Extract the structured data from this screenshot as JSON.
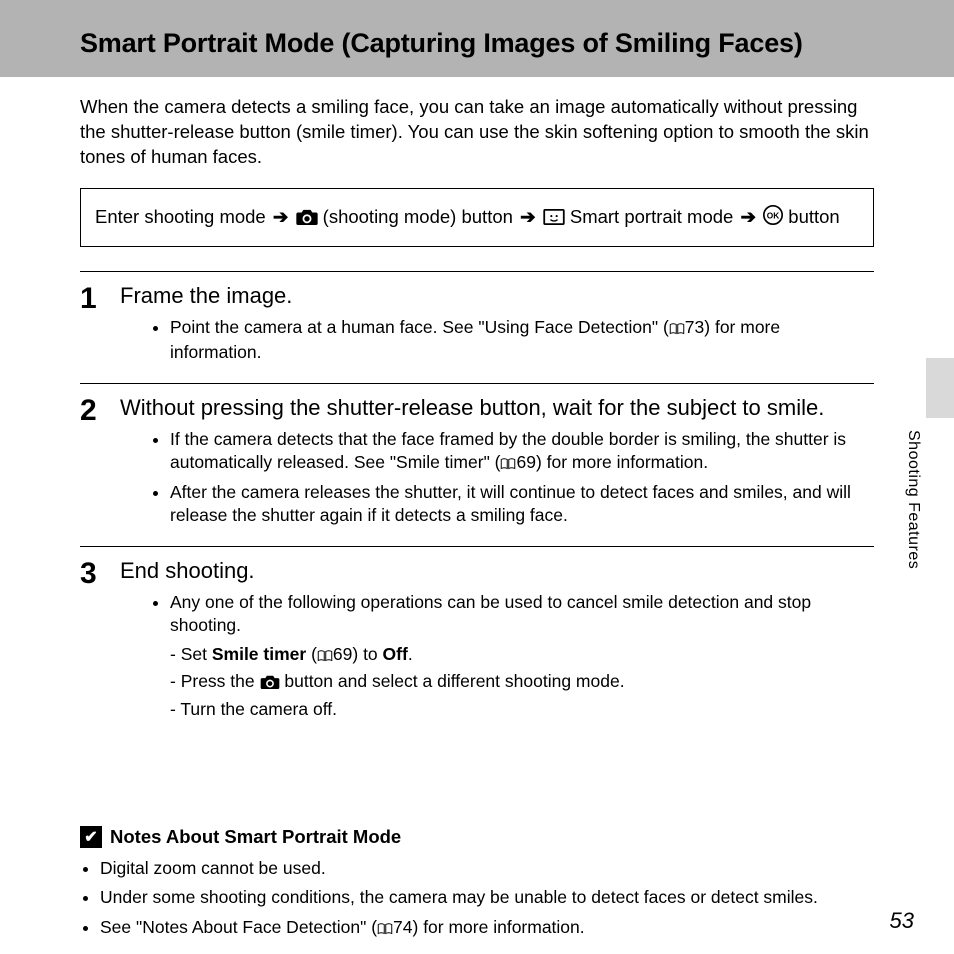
{
  "header": {
    "title": "Smart Portrait Mode (Capturing Images of Smiling Faces)"
  },
  "intro": "When the camera detects a smiling face, you can take an image automatically without pressing the shutter-release button (smile timer). You can use the skin softening option to smooth the skin tones of human faces.",
  "navbox": {
    "t1": "Enter shooting mode ",
    "t2": " (shooting mode) button ",
    "t3": " Smart portrait mode ",
    "t4": " button"
  },
  "steps": [
    {
      "num": "1",
      "title": "Frame the image.",
      "bullets": [
        {
          "pre": "Point the camera at a human face. See \"Using Face Detection\" (",
          "ref": "73",
          "post": ") for more information."
        }
      ]
    },
    {
      "num": "2",
      "title": "Without pressing the shutter-release button, wait for the subject to smile.",
      "bullets": [
        {
          "pre": "If the camera detects that the face framed by the double border is smiling, the shutter is automatically released. See \"Smile timer\" (",
          "ref": "69",
          "post": ") for more information."
        },
        {
          "pre": "After the camera releases the shutter, it will continue to detect faces and smiles, and will release the shutter again if it detects a smiling face.",
          "ref": "",
          "post": ""
        }
      ]
    },
    {
      "num": "3",
      "title": "End shooting.",
      "bullets": [
        {
          "pre": "Any one of the following operations can be used to cancel smile detection and stop shooting.",
          "ref": "",
          "post": ""
        }
      ],
      "dashes": {
        "d1a": "Set ",
        "d1b": "Smile timer",
        "d1c": " (",
        "d1ref": "69",
        "d1d": ") to ",
        "d1e": "Off",
        "d1f": ".",
        "d2a": "Press the ",
        "d2b": " button and select a different shooting mode.",
        "d3": "Turn the camera off."
      }
    }
  ],
  "notes": {
    "heading": "Notes About Smart Portrait Mode",
    "items": [
      {
        "pre": "Digital zoom cannot be used.",
        "ref": "",
        "post": ""
      },
      {
        "pre": "Under some shooting conditions, the camera may be unable to detect faces or detect smiles.",
        "ref": "",
        "post": ""
      },
      {
        "pre": "See \"Notes About Face Detection\" (",
        "ref": "74",
        "post": ") for more information."
      }
    ]
  },
  "side_label": "Shooting Features",
  "page_number": "53"
}
